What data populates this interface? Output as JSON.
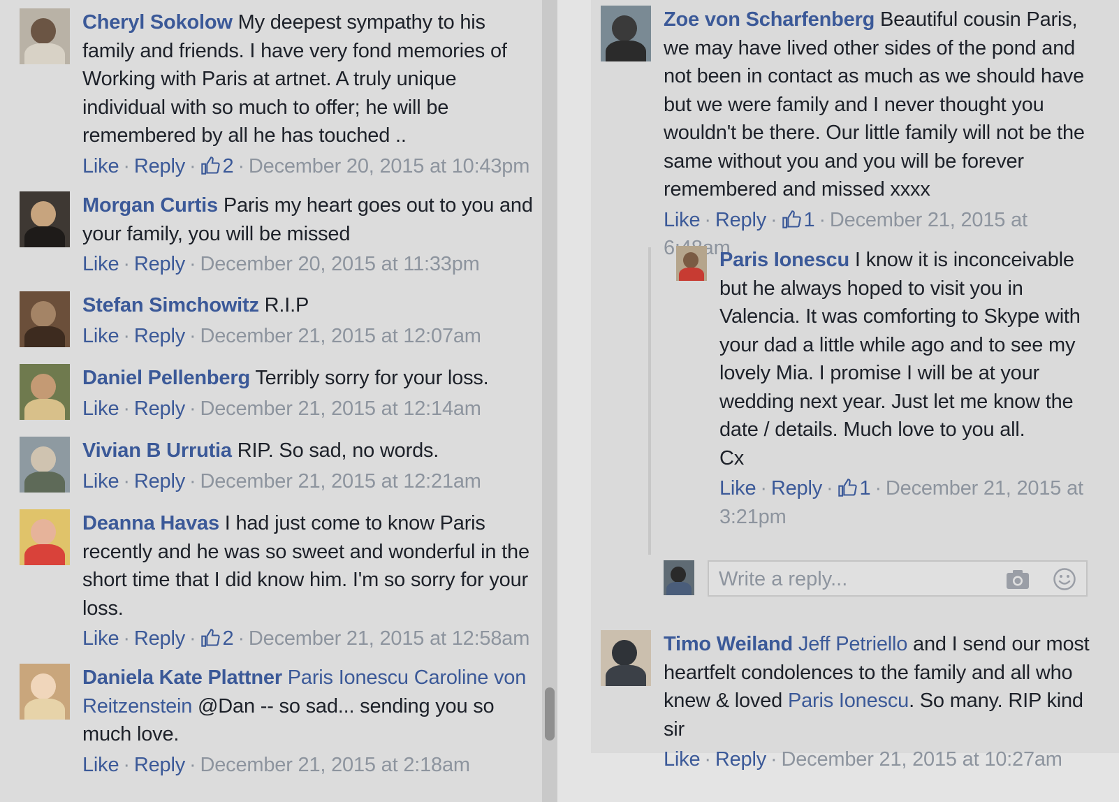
{
  "actions": {
    "like": "Like",
    "reply": "Reply",
    "sep": "·"
  },
  "left_comments": [
    {
      "author": "Cheryl Sokolow",
      "text": "My deepest sympathy to his family and friends. I have very fond memories of Working with Paris at artnet. A truly unique individual with so much to offer; he will be remembered by all he has touched ..",
      "likes": "2",
      "date": "December 20, 2015 at 10:43pm"
    },
    {
      "author": "Morgan Curtis",
      "text": "Paris my heart goes out to you and your family, you will be missed",
      "date": "December 20, 2015 at 11:33pm"
    },
    {
      "author": "Stefan Simchowitz",
      "text": "R.I.P",
      "date": "December 21, 2015 at 12:07am"
    },
    {
      "author": "Daniel Pellenberg",
      "text": "Terribly sorry for your loss.",
      "date": "December 21, 2015 at 12:14am"
    },
    {
      "author": "Vivian B Urrutia",
      "text": "RIP. So sad, no words.",
      "date": "December 21, 2015 at 12:21am"
    },
    {
      "author": "Deanna Havas",
      "text": "I had just come to know Paris recently and he was so sweet and wonderful in the short time that I did know him. I'm so sorry for your loss.",
      "likes": "2",
      "date": "December 21, 2015 at 12:58am"
    },
    {
      "author": "Daniela Kate Plattner",
      "tags": [
        "Paris Ionescu",
        "Caroline von Reitzenstein"
      ],
      "text": "@Dan -- so sad... sending you so much love.",
      "date": "December 21, 2015 at 2:18am"
    }
  ],
  "right_comments": {
    "zoe": {
      "author": "Zoe von Scharfenberg",
      "text": "Beautiful cousin Paris, we may have lived other sides of the pond and not been in contact as much as we should have but we were family and I never thought you wouldn't be there. Our little family will not be the same without you and you will be forever remembered and missed xxxx",
      "likes": "1",
      "date": "December 21, 2015 at 6:48am"
    },
    "paris_reply": {
      "author": "Paris Ionescu",
      "text": "I know it is inconceivable but he always hoped to visit you in Valencia. It was comforting to Skype with your dad a little while ago and to see my lovely Mia. I promise I will be at your wedding next year. Just let me know the date / details. Much love to you all.",
      "signoff": "Cx",
      "likes": "1",
      "date": "December 21, 2015 at 3:21pm"
    },
    "reply_box": {
      "placeholder": "Write a reply..."
    },
    "timo": {
      "author": "Timo Weiland",
      "tag1": "Jeff Petriello",
      "text1": "and I send our most heartfelt condolences to the family and all who knew & loved",
      "tag2": "Paris Ionescu",
      "text2": ". So many. RIP kind sir",
      "date": "December 21, 2015 at 10:27am"
    }
  },
  "icons": {
    "like": "thumbs-up-icon",
    "camera": "camera-icon",
    "emoji": "smiley-icon"
  },
  "colors": {
    "link": "#3b5998",
    "meta": "#8d949e",
    "text": "#1d2129",
    "panel": "#dcdcdc"
  }
}
